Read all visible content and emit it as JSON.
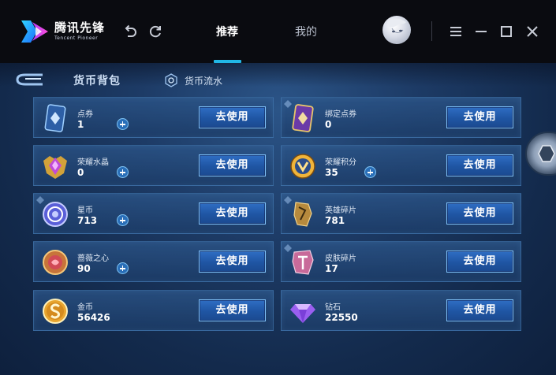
{
  "app": {
    "logo_cn": "腾讯先锋",
    "logo_en": "Tencent Pioneer"
  },
  "tabs": [
    {
      "label": "推荐",
      "active": true
    },
    {
      "label": "我的",
      "active": false
    }
  ],
  "page": {
    "title": "货币背包",
    "flow_link": "货币流水"
  },
  "colors": {
    "titlebar": "#0a0b10",
    "tab_underline": "#21b7e6",
    "button": "#1f55a3"
  },
  "currencies": [
    {
      "name": "点券",
      "value": "1",
      "plus": true,
      "button": "去使用",
      "icon": "coupon-card-icon"
    },
    {
      "name": "绑定点券",
      "value": "0",
      "plus": false,
      "button": "去使用",
      "icon": "bound-coupon-card-icon"
    },
    {
      "name": "荣耀水晶",
      "value": "0",
      "plus": true,
      "button": "去使用",
      "icon": "glory-crystal-icon"
    },
    {
      "name": "荣耀积分",
      "value": "35",
      "plus": true,
      "button": "去使用",
      "icon": "glory-points-icon"
    },
    {
      "name": "星币",
      "value": "713",
      "plus": true,
      "button": "去使用",
      "icon": "star-coin-icon"
    },
    {
      "name": "英雄碎片",
      "value": "781",
      "plus": false,
      "button": "去使用",
      "icon": "hero-shard-icon"
    },
    {
      "name": "蔷薇之心",
      "value": "90",
      "plus": true,
      "button": "去使用",
      "icon": "rose-heart-icon"
    },
    {
      "name": "皮肤碎片",
      "value": "17",
      "plus": false,
      "button": "去使用",
      "icon": "skin-shard-icon"
    },
    {
      "name": "金币",
      "value": "56426",
      "plus": false,
      "button": "去使用",
      "icon": "gold-coin-icon"
    },
    {
      "name": "钻石",
      "value": "22550",
      "plus": false,
      "button": "去使用",
      "icon": "diamond-icon"
    }
  ]
}
